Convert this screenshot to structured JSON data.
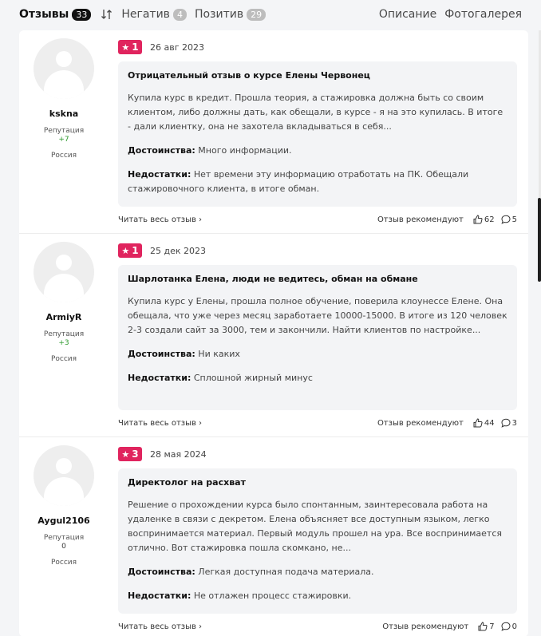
{
  "tabs": {
    "reviews_label": "Отзывы",
    "reviews_count": "33",
    "negative_label": "Негатив",
    "negative_count": "4",
    "positive_label": "Позитив",
    "positive_count": "29",
    "description_label": "Описание",
    "gallery_label": "Фотогалерея"
  },
  "labels": {
    "reputation": "Репутация",
    "pros": "Достоинства:",
    "cons": "Недостатки:",
    "read_more": "Читать весь отзыв ›",
    "recommended": "Отзыв рекомендуют"
  },
  "reviews": [
    {
      "author": "kskna",
      "reputation": "+7",
      "country": "Россия",
      "rating": "1",
      "date": "26 авг 2023",
      "title": "Отрицательный отзыв о курсе Елены Червонец",
      "text": "Купила курс в кредит. Прошла теория, а стажировка должна быть со своим клиентом, либо должны дать, как обещали, в курсе - я на это купилась. В итоге - дали клиентку, она не захотела вкладываться в себя...",
      "pros": "Много информации.",
      "cons": "Нет времени эту информацию отработать на ПК. Обещали стажировочного клиента, в итоге обман.",
      "likes": "62",
      "comments": "5"
    },
    {
      "author": "ArmiyR",
      "reputation": "+3",
      "country": "Россия",
      "rating": "1",
      "date": "25 дек 2023",
      "title": "Шарлотанка Елена, люди не ведитесь, обман на обмане",
      "text": "Купила курс у Елены, прошла полное обучение, поверила клоунессе Елене. Она обещала, что уже через месяц заработаете 10000-15000. В итоге из 120 человек 2-3 создали сайт за 3000, тем и закончили. Найти клиентов по настройке...",
      "pros": "Ни каких",
      "cons": "Сплошной жирный минус",
      "likes": "44",
      "comments": "3"
    },
    {
      "author": "Aygul2106",
      "reputation": "0",
      "country": "Россия",
      "rating": "3",
      "date": "28 мая 2024",
      "title": "Директолог на расхват",
      "text": "Решение о прохождении курса было спонтанным, заинтересовала работа на удаленке в связи с декретом. Елена объясняет все доступным языком, легко воспринимается материал. Первый модуль прошел на ура. Все воспринимается отлично. Вот стажировка пошла скомкано, не...",
      "pros": "Легкая доступная подача материала.",
      "cons": "Не отлажен процесс стажировки.",
      "likes": "7",
      "comments": "0"
    }
  ],
  "colors": {
    "rating_badge": "#e0245e",
    "reputation_positive": "#2e9a2e",
    "active_badge": "#111111",
    "inactive_badge": "#bdbdbd"
  },
  "icons": [
    "sort-icon",
    "star-icon",
    "thumbs-up-icon",
    "comment-icon",
    "avatar-placeholder-icon"
  ]
}
